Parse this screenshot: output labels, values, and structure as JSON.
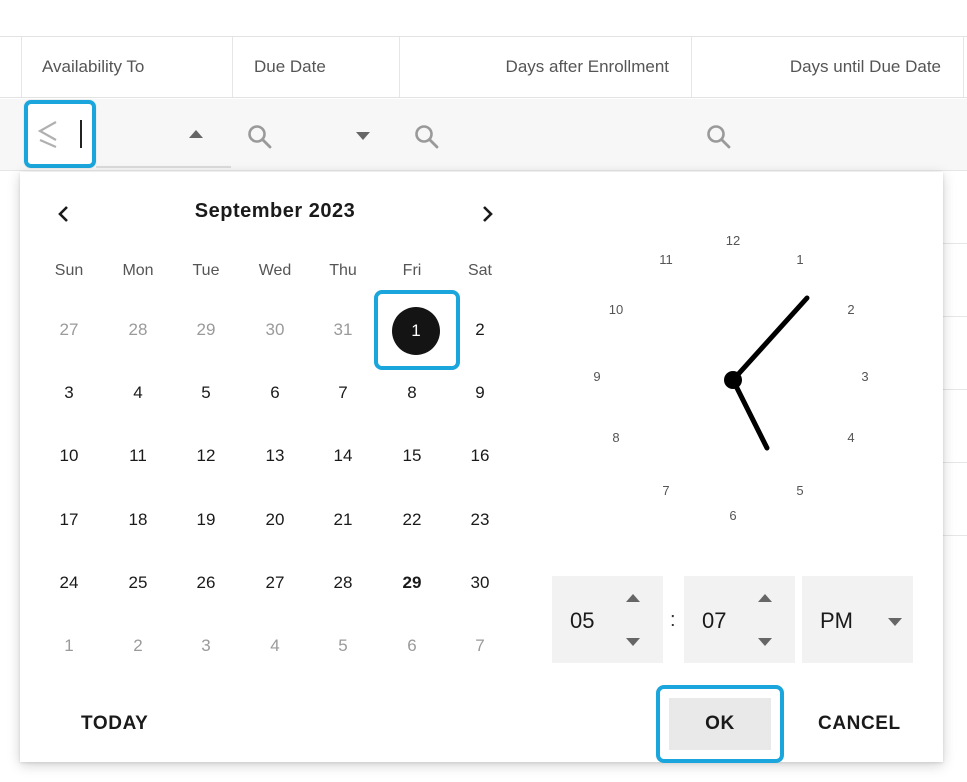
{
  "grid": {
    "columns": [
      "Availability To",
      "Due Date",
      "Days after Enrollment",
      "Days until Due Date"
    ]
  },
  "filter": {
    "operator_icon": "less-than-or-equal-icon",
    "search_icon": "search-icon"
  },
  "calendar": {
    "month_label": "September 2023",
    "weekdays": [
      "Sun",
      "Mon",
      "Tue",
      "Wed",
      "Thu",
      "Fri",
      "Sat"
    ],
    "weeks": [
      [
        "27",
        "28",
        "29",
        "30",
        "31",
        "1",
        "2"
      ],
      [
        "3",
        "4",
        "5",
        "6",
        "7",
        "8",
        "9"
      ],
      [
        "10",
        "11",
        "12",
        "13",
        "14",
        "15",
        "16"
      ],
      [
        "17",
        "18",
        "19",
        "20",
        "21",
        "22",
        "23"
      ],
      [
        "24",
        "25",
        "26",
        "27",
        "28",
        "29",
        "30"
      ],
      [
        "1",
        "2",
        "3",
        "4",
        "5",
        "6",
        "7"
      ]
    ],
    "selected_day": "1",
    "today_day": "29"
  },
  "clock": {
    "numbers": [
      "12",
      "1",
      "2",
      "3",
      "4",
      "5",
      "6",
      "7",
      "8",
      "9",
      "10",
      "11"
    ]
  },
  "time": {
    "hour": "05",
    "separator": ":",
    "minute": "07",
    "ampm": "PM"
  },
  "actions": {
    "today_label": "TODAY",
    "ok_label": "OK",
    "cancel_label": "CANCEL"
  },
  "colors": {
    "highlight": "#1aa6dc",
    "selected": "#141414"
  }
}
